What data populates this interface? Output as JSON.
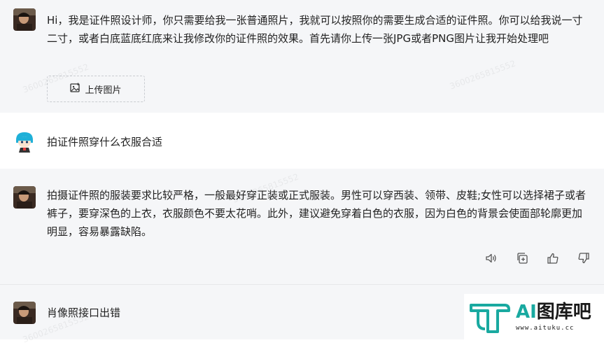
{
  "messages": [
    {
      "role": "bot",
      "text": "Hi，我是证件照设计师，你只需要给我一张普通照片，我就可以按照你的需要生成合适的证件照。你可以给我说一寸二寸，或者白底蓝底红底来让我修改你的证件照的效果。首先请你上传一张JPG或者PNG图片让我开始处理吧",
      "upload_label": "上传图片"
    },
    {
      "role": "user",
      "text": "拍证件照穿什么衣服合适"
    },
    {
      "role": "bot",
      "text": "拍摄证件照的服装要求比较严格，一般最好穿正装或正式服装。男性可以穿西装、领带、皮鞋;女性可以选择裙子或者裤子，要穿深色的上衣，衣服颜色不要太花哨。此外，建议避免穿着白色的衣服，因为白色的背景会使面部轮廓更加明显，容易暴露缺陷。"
    },
    {
      "role": "bot",
      "text": "肖像照接口出错"
    }
  ],
  "actions": {
    "speaker": "speaker-icon",
    "copy": "copy-icon",
    "like": "thumbs-up-icon",
    "dislike": "thumbs-down-icon"
  },
  "watermark_text": "3600265815552",
  "logo": {
    "main_ai": "AI",
    "main_rest": "图库吧",
    "url": "www.aituku.cc"
  },
  "colors": {
    "bot_bg": "#f5f6f8",
    "user_bg": "#ffffff",
    "logo_teal": "#19a9a0"
  }
}
